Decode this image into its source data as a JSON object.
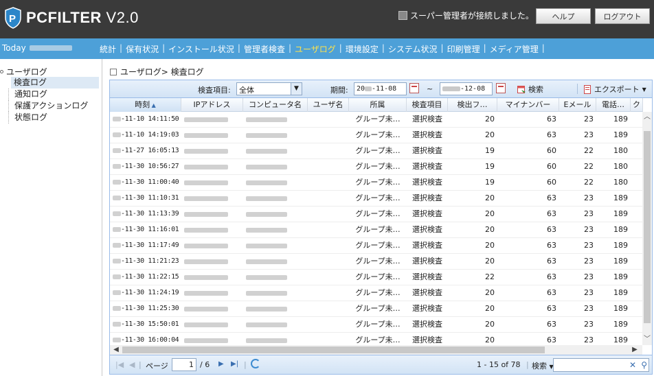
{
  "app": {
    "title_brand": "PCFILTER",
    "title_version": "V2.0"
  },
  "header": {
    "connected_text": "スーパー管理者が接続しました。",
    "help_label": "ヘルプ",
    "logout_label": "ログアウト"
  },
  "menubar": {
    "today_label": "Today",
    "items": [
      {
        "label": "統計"
      },
      {
        "label": "保有状況"
      },
      {
        "label": "インストール状況"
      },
      {
        "label": "管理者検査"
      },
      {
        "label": "ユーザログ",
        "active": true
      },
      {
        "label": "環境設定"
      },
      {
        "label": "システム状況"
      },
      {
        "label": "印刷管理"
      },
      {
        "label": "メディア管理"
      }
    ],
    "separator": "|",
    "active_color": "#ffe24a",
    "bar_color": "#4da0d8"
  },
  "sidebar": {
    "root": "ユーザログ",
    "items": [
      {
        "label": "検査ログ",
        "selected": true
      },
      {
        "label": "通知ログ"
      },
      {
        "label": "保護アクションログ"
      },
      {
        "label": "状態ログ"
      }
    ]
  },
  "main": {
    "title": "ユーザログ> 検査ログ",
    "toolbar": {
      "item_label": "検査項目:",
      "item_value": "全体",
      "period_label": "期間:",
      "date_from_suffix": "-11-08",
      "date_from_prefix": "20",
      "tilde": "~",
      "date_to_suffix": "-12-08",
      "search_label": "検索",
      "export_label": "エクスポート"
    },
    "columns": [
      "時刻",
      "IPアドレス",
      "コンピュータ名",
      "ユーザ名",
      "所属",
      "検査項目",
      "検出フ…",
      "マイナンバー",
      "Eメール",
      "電話…",
      "ク"
    ],
    "rows": [
      {
        "time": "-11-10 14:11:50",
        "group": "グループ未…",
        "item": "選択検査",
        "det": "20",
        "myno": "63",
        "email": "23",
        "tel": "189"
      },
      {
        "time": "-11-10 14:19:03",
        "group": "グループ未…",
        "item": "選択検査",
        "det": "20",
        "myno": "63",
        "email": "23",
        "tel": "189"
      },
      {
        "time": "-11-27 16:05:13",
        "group": "グループ未…",
        "item": "選択検査",
        "det": "19",
        "myno": "60",
        "email": "22",
        "tel": "180"
      },
      {
        "time": "-11-30 10:56:27",
        "group": "グループ未…",
        "item": "選択検査",
        "det": "19",
        "myno": "60",
        "email": "22",
        "tel": "180"
      },
      {
        "time": "-11-30 11:00:40",
        "group": "グループ未…",
        "item": "選択検査",
        "det": "19",
        "myno": "60",
        "email": "22",
        "tel": "180"
      },
      {
        "time": "-11-30 11:10:31",
        "group": "グループ未…",
        "item": "選択検査",
        "det": "20",
        "myno": "63",
        "email": "23",
        "tel": "189"
      },
      {
        "time": "-11-30 11:13:39",
        "group": "グループ未…",
        "item": "選択検査",
        "det": "20",
        "myno": "63",
        "email": "23",
        "tel": "189"
      },
      {
        "time": "-11-30 11:16:01",
        "group": "グループ未…",
        "item": "選択検査",
        "det": "20",
        "myno": "63",
        "email": "23",
        "tel": "189"
      },
      {
        "time": "-11-30 11:17:49",
        "group": "グループ未…",
        "item": "選択検査",
        "det": "20",
        "myno": "63",
        "email": "23",
        "tel": "189"
      },
      {
        "time": "-11-30 11:21:23",
        "group": "グループ未…",
        "item": "選択検査",
        "det": "20",
        "myno": "63",
        "email": "23",
        "tel": "189"
      },
      {
        "time": "-11-30 11:22:15",
        "group": "グループ未…",
        "item": "選択検査",
        "det": "22",
        "myno": "63",
        "email": "23",
        "tel": "189"
      },
      {
        "time": "-11-30 11:24:19",
        "group": "グループ未…",
        "item": "選択検査",
        "det": "20",
        "myno": "63",
        "email": "23",
        "tel": "189"
      },
      {
        "time": "-11-30 11:25:30",
        "group": "グループ未…",
        "item": "選択検査",
        "det": "20",
        "myno": "63",
        "email": "23",
        "tel": "189"
      },
      {
        "time": "-11-30 15:50:01",
        "group": "グループ未…",
        "item": "選択検査",
        "det": "20",
        "myno": "63",
        "email": "23",
        "tel": "189"
      },
      {
        "time": "-11-30 16:00:04",
        "group": "グループ未…",
        "item": "選択検査",
        "det": "20",
        "myno": "63",
        "email": "23",
        "tel": "189"
      }
    ],
    "pager": {
      "page_label": "ページ",
      "page_value": "1",
      "page_total": "/ 6",
      "range_text": "1 - 15 of 78",
      "search_label": "検索"
    }
  }
}
